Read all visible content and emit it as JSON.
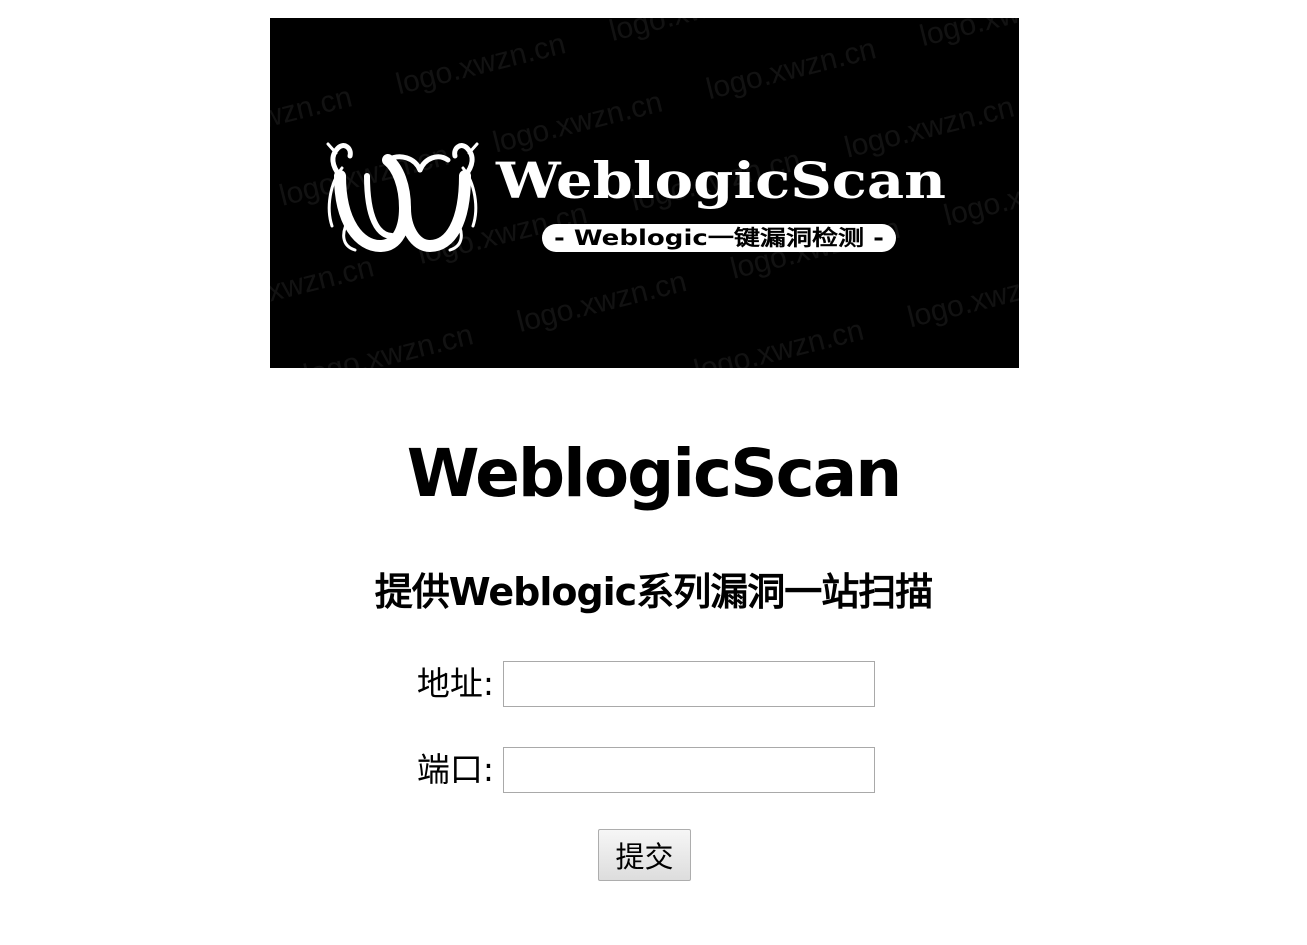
{
  "banner": {
    "logo_text": "WeblogicScan",
    "tagline": "- Weblogic一键漏洞检测 -",
    "watermark": "logo.xwzn.cn"
  },
  "page": {
    "title": "WeblogicScan",
    "subtitle": "提供Weblogic系列漏洞一站扫描"
  },
  "form": {
    "address_label": "地址:",
    "address_value": "",
    "port_label": "端口:",
    "port_value": "",
    "submit_label": "提交"
  },
  "colors": {
    "banner_background": "#000000",
    "logo_foreground": "#ffffff",
    "page_background": "#ffffff"
  }
}
